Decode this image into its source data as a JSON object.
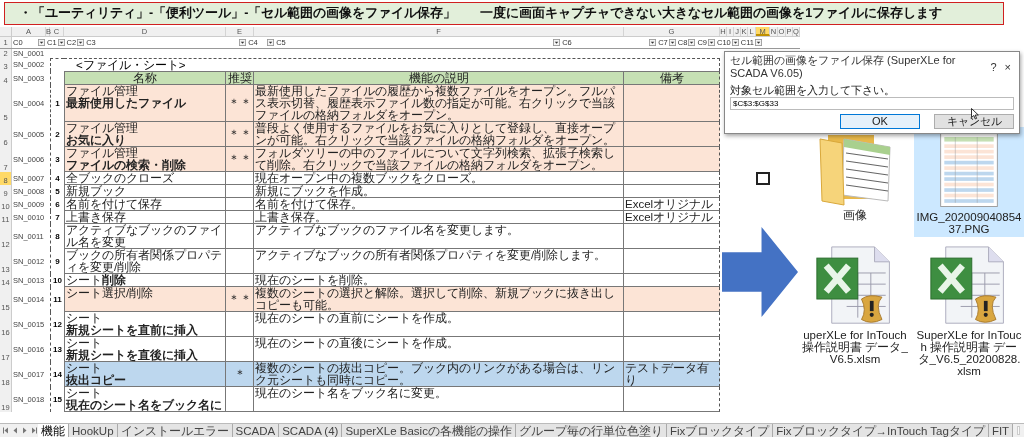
{
  "banner": {
    "lines": [
      "・「ユーティリティ」-「便利ツール」-「セル範囲の画像をファイル保存」",
      "一度に画面キャプチャできない大きなセル範囲の画像を1ファイルに保存します"
    ]
  },
  "sheet": {
    "columns": [
      {
        "label": "A",
        "selected": false
      },
      {
        "label": "B",
        "selected": false
      },
      {
        "label": "C",
        "selected": false
      },
      {
        "label": "D",
        "selected": false
      },
      {
        "label": "E",
        "selected": false
      },
      {
        "label": "F",
        "selected": false
      },
      {
        "label": "G",
        "selected": false
      },
      {
        "label": "H",
        "selected": false
      },
      {
        "label": "I",
        "selected": false
      },
      {
        "label": "J",
        "selected": false
      },
      {
        "label": "K",
        "selected": false
      },
      {
        "label": "L",
        "selected": false
      },
      {
        "label": "M",
        "selected": true
      },
      {
        "label": "N",
        "selected": false
      },
      {
        "label": "O",
        "selected": false
      },
      {
        "label": "P",
        "selected": false
      },
      {
        "label": "Q",
        "selected": false
      }
    ],
    "filter_row": {
      "number": "1",
      "filters": [
        "C0",
        "C1",
        "C2",
        "C3",
        "C4",
        "C5",
        "C6",
        "C7",
        "C8",
        "C9",
        "C10",
        "C11"
      ]
    },
    "rows": [
      {
        "kind": "blank",
        "number": "2",
        "label": "SN_0001",
        "selected": false
      },
      {
        "kind": "title",
        "number": "3",
        "label": "SN_0002",
        "selected": false,
        "title": "<ファイル・シート>"
      },
      {
        "kind": "header",
        "number": "4",
        "label": "SN_0003",
        "selected": false,
        "cells": [
          "名称",
          "推奨",
          "機能の説明",
          "備考"
        ]
      },
      {
        "kind": "item",
        "number": "5",
        "label": "SN_0004",
        "selected": false,
        "no": "1",
        "category": "ファイル管理",
        "name": "最新使用したファイル",
        "emphasis": true,
        "recommend": "＊＊",
        "description": "最新使用したファイルの履歴から複数ファイルをオープン。フルパス表示切替、履歴表示ファイル数の指定が可能。右クリックで当該ファイルの格納フォルダをオープン。",
        "color": "#fce4d6"
      },
      {
        "kind": "item",
        "number": "6",
        "label": "SN_0005",
        "selected": false,
        "no": "2",
        "category": "ファイル管理",
        "name": "お気に入り",
        "emphasis": true,
        "recommend": "＊＊",
        "description": "普段よく使用するファイルをお気に入りとして登録し、直接オープンが可能。右クリックで当該ファイルの格納フォルダをオープン。",
        "color": "#fce4d6"
      },
      {
        "kind": "item",
        "number": "7",
        "label": "SN_0006",
        "selected": false,
        "no": "3",
        "category": "ファイル管理",
        "name": "ファイルの検索・削除",
        "emphasis": true,
        "recommend": "＊＊",
        "description": "フォルダツリーの中のファイルについて文字列検索、拡張子検索して削除。右クリックで当該ファイルの格納フォルダをオープン。",
        "color": "#fce4d6"
      },
      {
        "kind": "item",
        "number": "8",
        "label": "SN_0007",
        "selected": true,
        "no": "4",
        "name": "全ブックのクローズ",
        "emphasis": false,
        "description": "現在オープン中の複数ブックをクローズ。",
        "color": "#ffffff"
      },
      {
        "kind": "item",
        "number": "9",
        "label": "SN_0008",
        "selected": false,
        "no": "5",
        "name": "新規ブック",
        "emphasis": false,
        "description": "新規にブックを作成。",
        "color": "#ffffff"
      },
      {
        "kind": "item",
        "number": "10",
        "label": "SN_0009",
        "selected": false,
        "no": "6",
        "name": "名前を付けて保存",
        "emphasis": false,
        "description": "名前を付けて保存。",
        "note": "Excelオリジナル",
        "color": "#ffffff"
      },
      {
        "kind": "item",
        "number": "11",
        "label": "SN_0010",
        "selected": false,
        "no": "7",
        "name": "上書き保存",
        "emphasis": false,
        "description": "上書き保存。",
        "note": "Excelオリジナル",
        "color": "#ffffff"
      },
      {
        "kind": "item",
        "number": "12",
        "label": "SN_0011",
        "selected": false,
        "no": "8",
        "name": "アクティブなブックのファイル名を変更",
        "emphasis": false,
        "description": "アクティブなブックのファイル名を変更します。",
        "color": "#ffffff"
      },
      {
        "kind": "item",
        "number": "13",
        "label": "SN_0012",
        "selected": false,
        "no": "9",
        "name": "ブックの所有者関係プロパティを変更/削除",
        "emphasis": false,
        "description": "アクティブなブックの所有者関係プロパティを変更/削除します。",
        "color": "#ffffff"
      },
      {
        "kind": "item",
        "number": "14",
        "label": "SN_0013",
        "selected": false,
        "no": "10",
        "name": "シート**削除**",
        "emphasis": false,
        "description": "現在のシートを削除。",
        "color": "#ffffff"
      },
      {
        "kind": "item",
        "number": "15",
        "label": "SN_0014",
        "selected": false,
        "no": "11",
        "name": "シート選択/削除",
        "emphasis": false,
        "recommend": "＊＊",
        "description": "複数のシートの選択と解除。選択して削除、新規ブックに抜き出しコピーも可能。",
        "color": "#fce4d6"
      },
      {
        "kind": "item",
        "number": "16",
        "label": "SN_0015",
        "selected": false,
        "no": "12",
        "category": "シート",
        "name": "新規シートを直前に挿入",
        "emphasis": true,
        "description": "現在のシートの直前にシートを作成。",
        "color": "#ffffff"
      },
      {
        "kind": "item",
        "number": "17",
        "label": "SN_0016",
        "selected": false,
        "no": "13",
        "category": "シート",
        "name": "新規シートを直後に挿入",
        "emphasis": true,
        "description": "現在のシートの直後にシートを作成。",
        "color": "#ffffff"
      },
      {
        "kind": "item",
        "number": "18",
        "label": "SN_0017",
        "selected": false,
        "no": "14",
        "category": "シート",
        "name": "抜出コピー",
        "emphasis": true,
        "recommend": "＊",
        "description": "複数のシートの抜出コピー。ブック内のリンクがある場合は、リンク元シートも同時にコピー。",
        "note": "テストデータ有り",
        "color": "#bdd7ee"
      },
      {
        "kind": "item",
        "number": "19",
        "label": "SN_0018",
        "selected": false,
        "no": "15",
        "category": "シート",
        "name": "現在のシート名をブック名に",
        "emphasis": true,
        "description": "現在のシート名をブック名に変更。",
        "color": "#ffffff"
      }
    ]
  },
  "tabs": [
    {
      "label": "機能",
      "selected": true
    },
    {
      "label": "HookUp",
      "selected": false
    },
    {
      "label": "インストールエラー",
      "selected": false
    },
    {
      "label": "SCADA",
      "selected": false
    },
    {
      "label": "SCADA (4)",
      "selected": false
    },
    {
      "label": "SuperXLe Basicの各機能の操作",
      "selected": false
    },
    {
      "label": "グループ毎の行単位色塗り",
      "selected": false
    },
    {
      "label": "Fixブロックタイプ",
      "selected": false
    },
    {
      "label": "Fixブロックタイプ→InTouch Tagタイプ",
      "selected": false
    },
    {
      "label": "FIT",
      "selected": false
    }
  ],
  "dialog": {
    "title": "セル範囲の画像をファイル保存 (SuperXLe for SCADA V6.05)",
    "help": "?",
    "close": "×",
    "prompt": "対象セル範囲を入力して下さい。",
    "value": "$C$3:$G$33",
    "buttons": [
      {
        "label": "OK",
        "selected": true
      },
      {
        "label": "キャンセル",
        "selected": false
      }
    ]
  },
  "files": [
    {
      "kind": "folder",
      "name": "画像",
      "selected": false
    },
    {
      "kind": "image",
      "name": "IMG_20200904085437.PNG",
      "selected": true
    },
    {
      "kind": "excel",
      "name": "uperXLe for InTouch 操作説明書 データ_V6.5.xlsm",
      "selected": false
    },
    {
      "kind": "excel",
      "name": "SuperXLe for InTouch 操作説明書 データ_V6.5_20200828.xlsm",
      "selected": false
    }
  ]
}
